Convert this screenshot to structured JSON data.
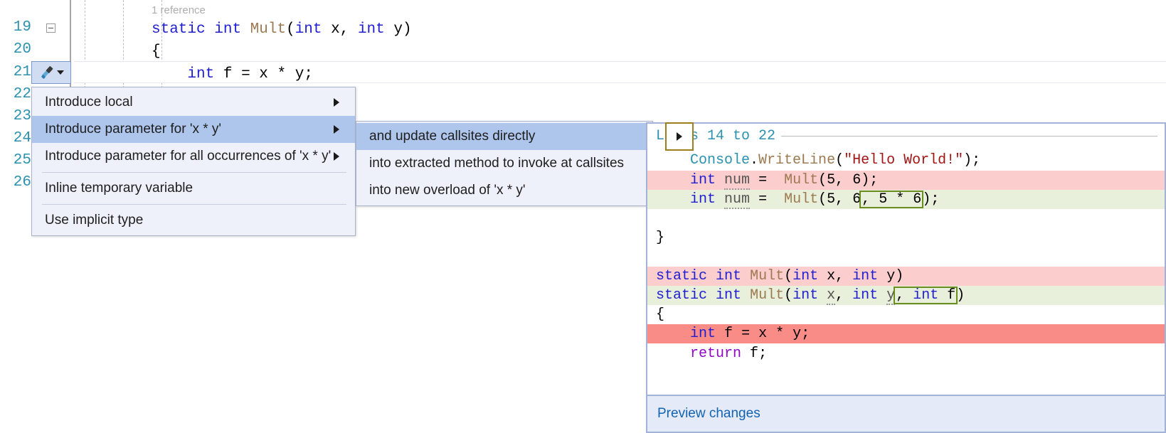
{
  "editor": {
    "codelens": "1 reference",
    "line_numbers": [
      "19",
      "20",
      "21",
      "22",
      "23",
      "24",
      "25",
      "26"
    ],
    "lines": [
      {
        "number": "19",
        "text": "static int Mult(int x, int y)"
      },
      {
        "number": "20",
        "text": "{"
      },
      {
        "number": "21",
        "text": "    int f = x * y;"
      }
    ],
    "quick_actions_button": {
      "icon": "screwdriver-icon",
      "dropdown_icon": "chevron-down-icon"
    }
  },
  "main_menu": {
    "items": [
      {
        "label": "Introduce local",
        "has_submenu": true,
        "selected": false,
        "separator_after": false
      },
      {
        "label": "Introduce parameter for 'x * y'",
        "has_submenu": true,
        "selected": true,
        "separator_after": false
      },
      {
        "label": "Introduce parameter for all occurrences of 'x * y'",
        "has_submenu": true,
        "selected": false,
        "separator_after": true
      },
      {
        "label": "Inline temporary variable",
        "has_submenu": false,
        "selected": false,
        "separator_after": true
      },
      {
        "label": "Use implicit type",
        "has_submenu": false,
        "selected": false,
        "separator_after": false
      }
    ]
  },
  "sub_menu": {
    "items": [
      {
        "label": "and update callsites directly",
        "selected": true
      },
      {
        "label": "into extracted method to invoke at callsites",
        "selected": false
      },
      {
        "label": "into new overload of 'x * y'",
        "selected": false
      }
    ]
  },
  "preview": {
    "header": "Lines 14 to 22",
    "footer_link": "Preview changes",
    "code": [
      {
        "kind": "plain",
        "text": "    Console.WriteLine(\"Hello World!\");"
      },
      {
        "kind": "del",
        "text": "    int num =  Mult(5, 6);"
      },
      {
        "kind": "add",
        "text": "    int num =  Mult(5, 6, 5 * 6);"
      },
      {
        "kind": "plain",
        "text": ""
      },
      {
        "kind": "plain",
        "text": "}"
      },
      {
        "kind": "plain",
        "text": ""
      },
      {
        "kind": "del",
        "text": "static int Mult(int x, int y)"
      },
      {
        "kind": "add",
        "text": "static int Mult(int x, int y, int f)"
      },
      {
        "kind": "plain",
        "text": "{"
      },
      {
        "kind": "delhot",
        "text": "    int f = x * y;"
      },
      {
        "kind": "plain",
        "text": "    return f;"
      }
    ]
  },
  "colors": {
    "keyword": "#1f1fd1",
    "type": "#2b91af",
    "method": "#9d7a51",
    "string": "#a31515",
    "control": "#8f08c4",
    "line_number": "#2b91af",
    "menu_bg": "#eef1fa",
    "menu_selected": "#aec5ec",
    "diff_deleted": "#fbcdcd",
    "diff_deleted_focus": "#fa8c87",
    "diff_added": "#e8efda",
    "change_outline": "#6b8e23",
    "panel_border": "#a2b2d8",
    "link": "#1263b0",
    "arrow_tile_border": "#9d7e1d"
  }
}
